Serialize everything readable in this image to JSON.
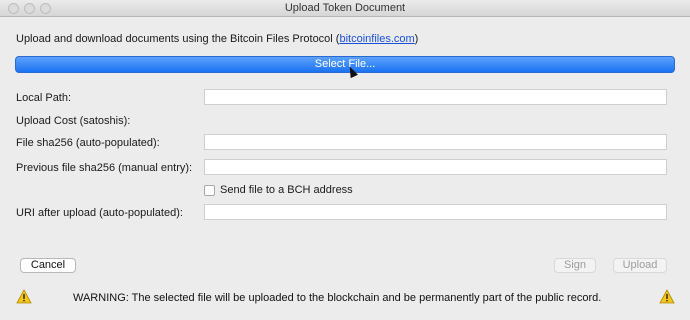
{
  "window": {
    "title": "Upload Token Document"
  },
  "intro": {
    "text": "Upload and download documents using the Bitcoin Files Protocol (",
    "link": "bitcoinfiles.com",
    "suffix": ")"
  },
  "select_button": {
    "label": "Select File..."
  },
  "fields": {
    "local_path": {
      "label": "Local Path:",
      "value": ""
    },
    "upload_cost": {
      "label": "Upload Cost (satoshis):"
    },
    "file_sha256": {
      "label": "File sha256 (auto-populated):",
      "value": ""
    },
    "previous_sha256": {
      "label": "Previous file sha256 (manual entry):",
      "value": ""
    },
    "send_to_bch": {
      "label": "Send file to a BCH address",
      "checked": false
    },
    "uri_after_upload": {
      "label": "URI after upload (auto-populated):",
      "value": ""
    }
  },
  "buttons": {
    "cancel": "Cancel",
    "sign": "Sign",
    "upload": "Upload"
  },
  "warning": {
    "text": "WARNING: The selected file will be uploaded to the blockchain and be permanently part of the public record."
  },
  "colors": {
    "accent": "#1b72f2",
    "link": "#1a4fd6",
    "warning_yellow": "#f5c518"
  },
  "icons": [
    "close-icon",
    "minimize-icon",
    "maximize-icon",
    "warning-icon"
  ]
}
